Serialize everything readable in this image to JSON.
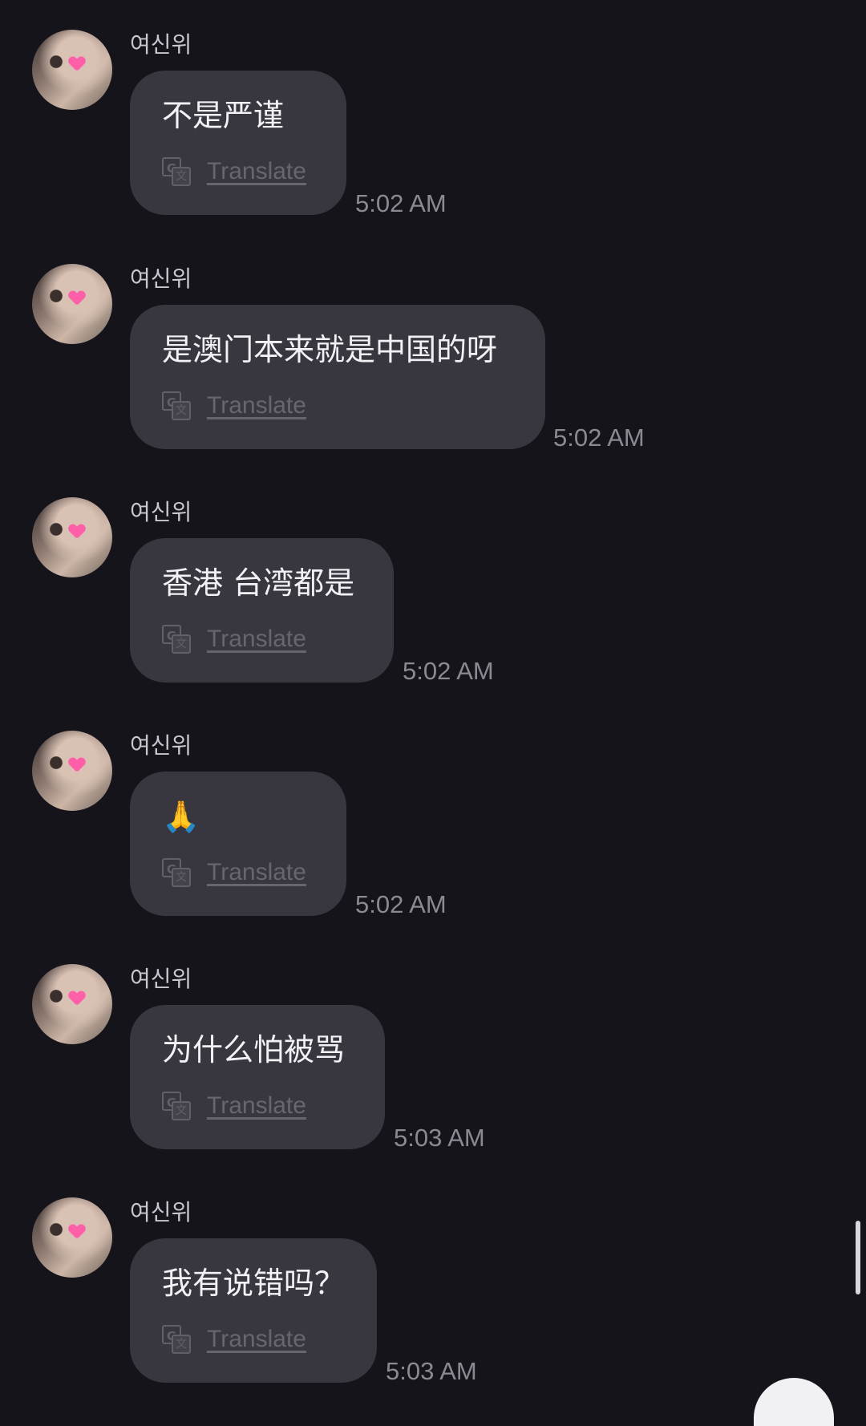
{
  "conversation": {
    "messages": [
      {
        "sender": "여신위",
        "text": "不是严谨",
        "translate": "Translate",
        "time": "5:02 AM"
      },
      {
        "sender": "여신위",
        "text": "是澳门本来就是中国的呀",
        "translate": "Translate",
        "time": "5:02 AM"
      },
      {
        "sender": "여신위",
        "text": "香港 台湾都是",
        "translate": "Translate",
        "time": "5:02 AM"
      },
      {
        "sender": "여신위",
        "text": "🙏",
        "translate": "Translate",
        "time": "5:02 AM"
      },
      {
        "sender": "여신위",
        "text": "为什么怕被骂",
        "translate": "Translate",
        "time": "5:03 AM"
      },
      {
        "sender": "여신위",
        "text": "我有说错吗？",
        "translate": "Translate",
        "time": "5:03 AM"
      }
    ]
  },
  "icons": {
    "translate": "google-translate-icon",
    "avatar_decoration": "heart-icon"
  },
  "colors": {
    "background": "#15141b",
    "bubble": "#38373f",
    "text": "#f2f1f5",
    "muted": "#8b8a92"
  }
}
